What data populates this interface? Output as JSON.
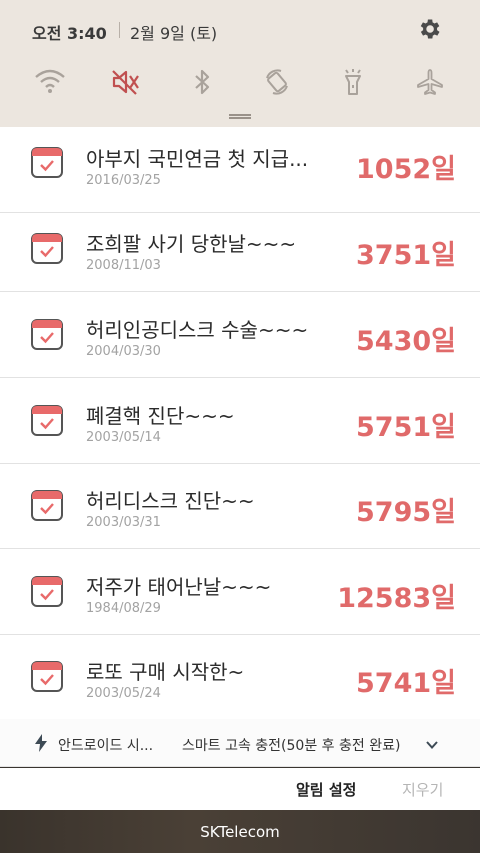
{
  "status": {
    "time": "오전 3:40",
    "date": "2월 9일 (토)"
  },
  "quick_toggles": [
    {
      "name": "wifi-icon",
      "active": false
    },
    {
      "name": "mute-icon",
      "active": true
    },
    {
      "name": "bluetooth-icon",
      "active": false
    },
    {
      "name": "auto-rotate-icon",
      "active": false
    },
    {
      "name": "flashlight-icon",
      "active": false
    },
    {
      "name": "airplane-mode-icon",
      "active": false
    }
  ],
  "colors": {
    "accent": "#e06a6a",
    "panel": "#ece6df",
    "inactive_icon": "#a9a29b"
  },
  "notifications": [
    {
      "title": "아부지 국민연금 첫 지급...",
      "date": "2016/03/25",
      "count": "1052일"
    },
    {
      "title": "조희팔 사기 당한날~~~",
      "date": "2008/11/03",
      "count": "3751일"
    },
    {
      "title": "허리인공디스크 수술~~~",
      "date": "2004/03/30",
      "count": "5430일"
    },
    {
      "title": "폐결핵 진단~~~",
      "date": "2003/05/14",
      "count": "5751일"
    },
    {
      "title": "허리디스크 진단~~",
      "date": "2003/03/31",
      "count": "5795일"
    },
    {
      "title": "저주가 태어난날~~~",
      "date": "1984/08/29",
      "count": "12583일"
    },
    {
      "title": "로또 구매 시작한~",
      "date": "2003/05/24",
      "count": "5741일"
    }
  ],
  "charging": {
    "app": "안드로이드 시...",
    "status": "스마트 고속 충전(50분 후 충전 완료)"
  },
  "actions": {
    "settings": "알림 설정",
    "clear": "지우기"
  },
  "carrier": "SKTelecom"
}
